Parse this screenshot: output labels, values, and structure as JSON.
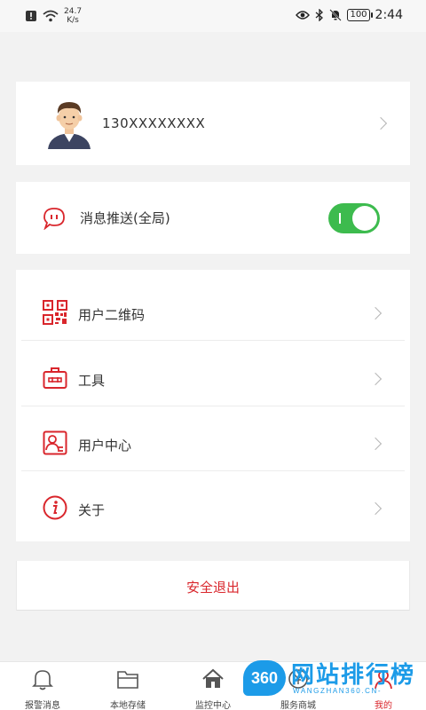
{
  "statusbar": {
    "speed_value": "24.7",
    "speed_unit": "K/s",
    "battery": "100",
    "time": "2:44"
  },
  "profile": {
    "phone": "130XXXXXXXX"
  },
  "push": {
    "label": "消息推送(全局)",
    "enabled": true
  },
  "menu": {
    "items": [
      {
        "label": "用户二维码",
        "icon": "qrcode-icon"
      },
      {
        "label": "工具",
        "icon": "toolbox-icon"
      },
      {
        "label": "用户中心",
        "icon": "user-card-icon"
      },
      {
        "label": "关于",
        "icon": "info-icon"
      }
    ]
  },
  "logout": {
    "label": "安全退出"
  },
  "tabbar": {
    "tabs": [
      {
        "label": "报警消息",
        "icon": "bell-icon"
      },
      {
        "label": "本地存储",
        "icon": "folder-icon"
      },
      {
        "label": "监控中心",
        "icon": "home-icon"
      },
      {
        "label": "服务商城",
        "icon": "shop-icon"
      },
      {
        "label": "我的",
        "icon": "user-icon"
      }
    ],
    "active_index": 4
  },
  "watermark": {
    "badge": "360",
    "text": "网站排行榜",
    "sub": "WANGZHAN360.CN-"
  },
  "colors": {
    "accent": "#d9262c",
    "toggle_on": "#3dbb4e",
    "watermark": "#1c9be8"
  }
}
